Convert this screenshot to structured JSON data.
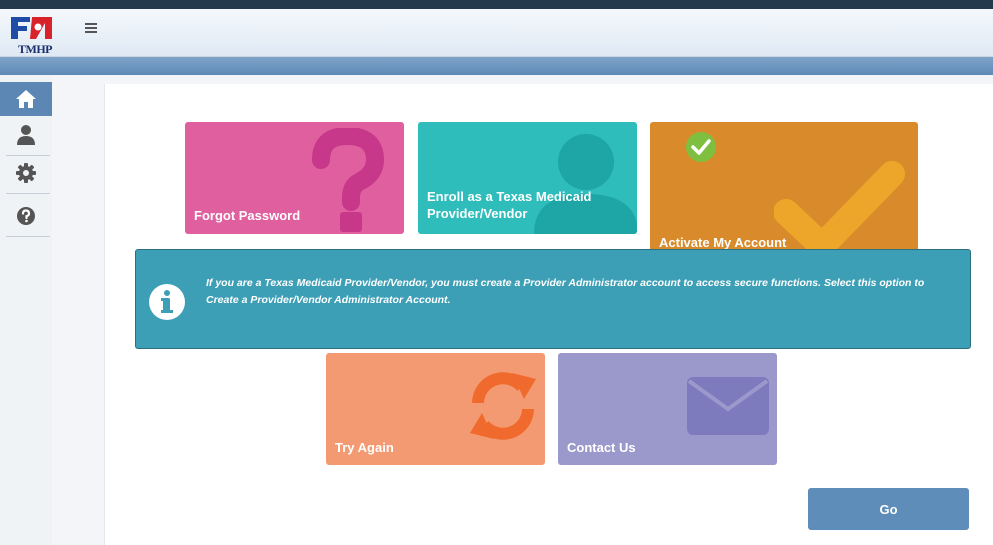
{
  "header": {
    "logo_text": "TMHP",
    "menu_icon": "hamburger-icon"
  },
  "sidebar": {
    "items": [
      {
        "icon": "home-icon",
        "active": true
      },
      {
        "icon": "user-icon",
        "active": false
      },
      {
        "icon": "gear-icon",
        "active": false
      },
      {
        "icon": "help-icon",
        "active": false
      }
    ]
  },
  "tiles": {
    "forgot_password": {
      "label": "Forgot Password",
      "color": "#e0609f",
      "icon": "question-icon"
    },
    "enroll": {
      "label": "Enroll as a Texas Medicaid Provider/Vendor",
      "color": "#2ebdbb",
      "icon": "person-icon"
    },
    "activate": {
      "label": "Activate My Account",
      "color": "#d98b2b",
      "icon": "checkmark-icon",
      "badge_icon": "check-circle-icon"
    },
    "try_again": {
      "label": "Try Again",
      "color": "#f49a72",
      "icon": "refresh-icon"
    },
    "contact_us": {
      "label": "Contact Us",
      "color": "#9b98cc",
      "icon": "envelope-icon"
    }
  },
  "info_box": {
    "icon": "info-icon",
    "text": "If you are a Texas Medicaid Provider/Vendor, you must create a Provider Administrator account to access secure functions. Select this option to Create a Provider/Vendor Administrator Account.",
    "color": "#3d9fb6"
  },
  "go_button": {
    "label": "Go"
  }
}
